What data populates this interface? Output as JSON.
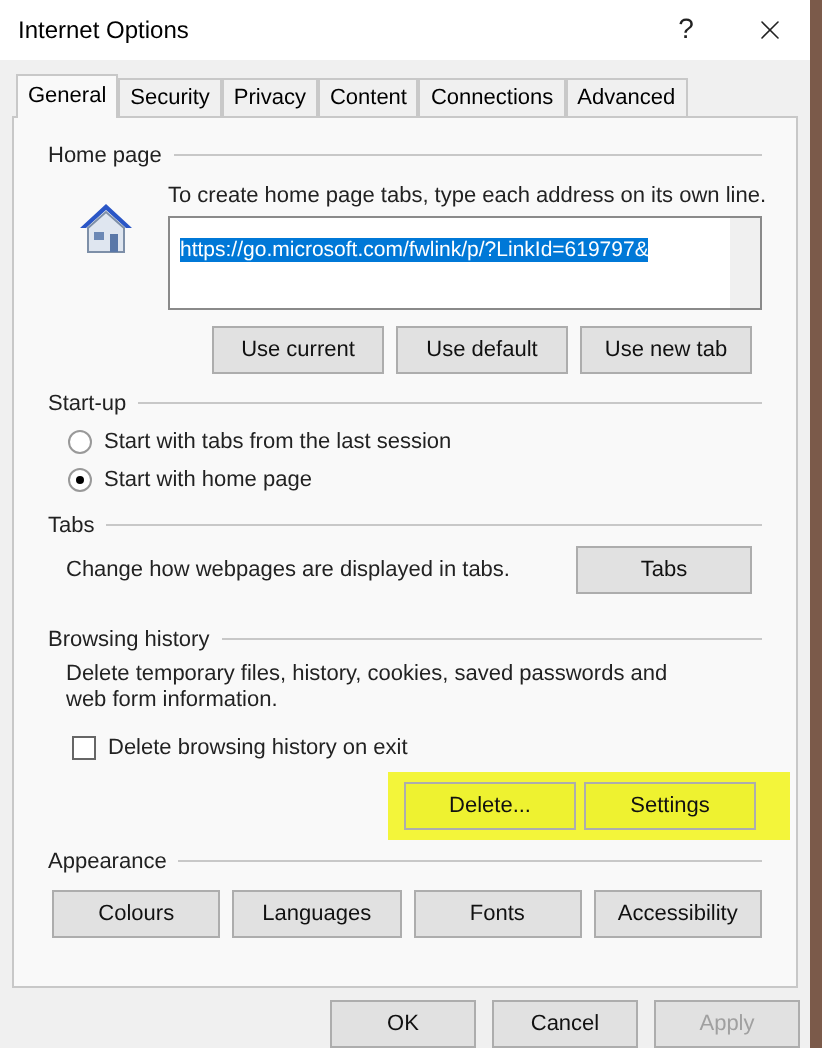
{
  "window": {
    "title": "Internet Options",
    "help": "?"
  },
  "tabs": [
    {
      "label": "General",
      "selected": true
    },
    {
      "label": "Security",
      "selected": false
    },
    {
      "label": "Privacy",
      "selected": false
    },
    {
      "label": "Content",
      "selected": false
    },
    {
      "label": "Connections",
      "selected": false
    },
    {
      "label": "Advanced",
      "selected": false
    }
  ],
  "home_page": {
    "legend": "Home page",
    "instruction": "To create home page tabs, type each address on its own line.",
    "address": "https://go.microsoft.com/fwlink/p/?LinkId=619797&",
    "buttons": [
      "Use current",
      "Use default",
      "Use new tab"
    ]
  },
  "startup": {
    "legend": "Start-up",
    "options": [
      {
        "label": "Start with tabs from the last session",
        "selected": false
      },
      {
        "label": "Start with home page",
        "selected": true
      }
    ]
  },
  "tabs_section": {
    "legend": "Tabs",
    "description": "Change how webpages are displayed in tabs.",
    "button": "Tabs"
  },
  "browsing_history": {
    "legend": "Browsing history",
    "description": "Delete temporary files, history, cookies, saved passwords and web form information.",
    "checkbox": {
      "label": "Delete browsing history on exit",
      "checked": false
    },
    "highlighted": true,
    "buttons": [
      "Delete...",
      "Settings"
    ]
  },
  "appearance": {
    "legend": "Appearance",
    "buttons": [
      "Colours",
      "Languages",
      "Fonts",
      "Accessibility"
    ]
  },
  "footer": [
    {
      "label": "OK",
      "disabled": false
    },
    {
      "label": "Cancel",
      "disabled": false
    },
    {
      "label": "Apply",
      "disabled": true
    }
  ]
}
